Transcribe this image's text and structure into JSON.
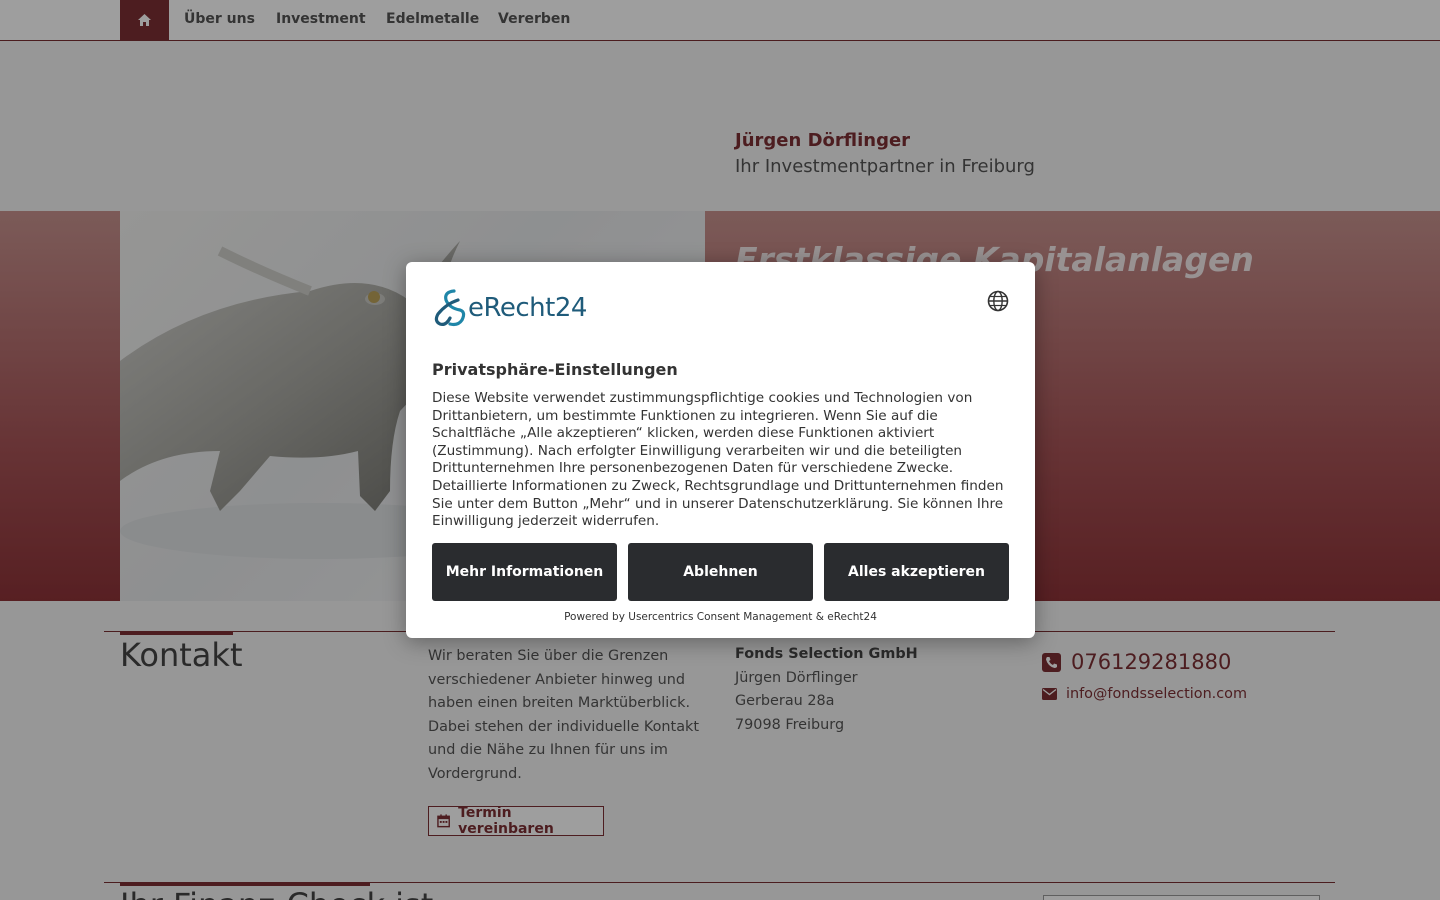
{
  "nav": {
    "items": [
      "Über uns",
      "Investment",
      "Edelmetalle",
      "Vererben"
    ]
  },
  "header": {
    "name": "Jürgen Dörflinger",
    "subtitle": "Ihr Investmentpartner in Freiburg"
  },
  "hero": {
    "title": "Erstklassige Kapitalanlagen"
  },
  "kontakt": {
    "title": "Kontakt",
    "text": "Wir beraten Sie über die Grenzen verschiedener Anbieter hinweg und haben einen breiten Marktüberblick. Dabei stehen der individuelle Kontakt und die Nähe zu Ihnen für uns im Vordergrund.",
    "button_label": "Termin vereinbaren",
    "company": "Fonds Selection GmbH",
    "person": "Jürgen Dörflinger",
    "street": "Gerberau 28a",
    "city": "79098 Freiburg",
    "phone": "076129281880",
    "email": "info@fondsselection.com"
  },
  "section2": {
    "title": "Ihr Finanz-Check ist"
  },
  "consent": {
    "logo_text": "eRecht24",
    "title": "Privatsphäre-Einstellungen",
    "body": "Diese Website verwendet zustimmungspflichtige cookies und Technologien von Drittanbietern, um bestimmte Funktionen zu integrieren. Wenn Sie auf die Schaltfläche „Alle akzeptieren“ klicken, werden diese Funktionen aktiviert (Zustimmung). Nach erfolgter Einwilligung verarbeiten wir und die beteiligten Drittunternehmen Ihre personenbezogenen Daten für verschiedene Zwecke. Detaillierte Informationen zu Zweck, Rechtsgrundlage und Drittunternehmen finden Sie unter dem Button „Mehr“ und in unserer Datenschutzerklärung. Sie können Ihre Einwilligung jederzeit widerrufen.",
    "more_label": "Mehr Informationen",
    "deny_label": "Ablehnen",
    "accept_label": "Alles akzeptieren",
    "footer": "Powered by Usercentrics Consent Management & eRecht24"
  },
  "colors": {
    "brand": "#7d3035",
    "button_dark": "#2a2c2f",
    "logo_blue": "#1f5b7a"
  },
  "icons": [
    "home-icon",
    "calendar-icon",
    "phone-icon",
    "mail-icon",
    "globe-icon",
    "erecht24-logo-icon"
  ]
}
